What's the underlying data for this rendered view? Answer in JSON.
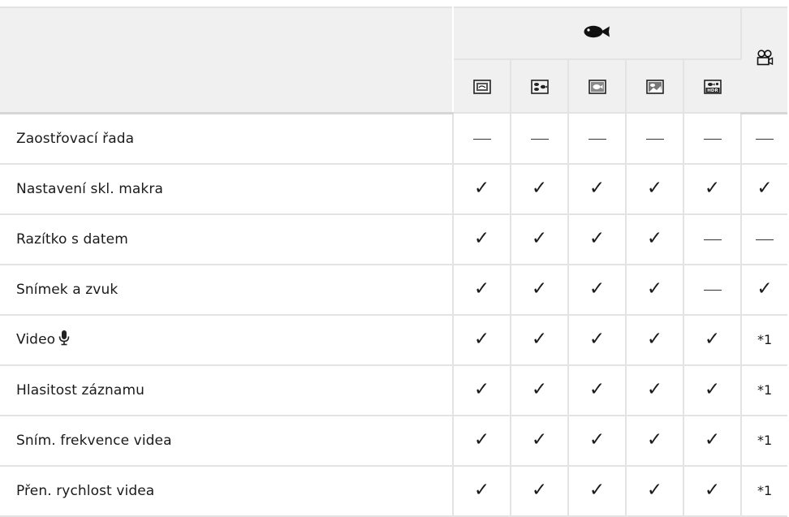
{
  "header": {
    "group_icon": "underwater-fish-icon",
    "movie_icon": "movie-camera-icon",
    "modes": [
      {
        "icon": "underwater-wide-icon"
      },
      {
        "icon": "underwater-macro-icon"
      },
      {
        "icon": "underwater-snapshot-icon"
      },
      {
        "icon": "underwater-landscape-icon"
      },
      {
        "icon": "underwater-hdr-icon",
        "badge": "HDR"
      }
    ]
  },
  "rows": [
    {
      "label": "Zaostřovací řada",
      "values": [
        "—",
        "—",
        "—",
        "—",
        "—",
        "—"
      ]
    },
    {
      "label": "Nastavení skl. makra",
      "values": [
        "✓",
        "✓",
        "✓",
        "✓",
        "✓",
        "✓"
      ]
    },
    {
      "label": "Razítko s datem",
      "values": [
        "✓",
        "✓",
        "✓",
        "✓",
        "—",
        "—"
      ]
    },
    {
      "label": "Snímek a zvuk",
      "values": [
        "✓",
        "✓",
        "✓",
        "✓",
        "—",
        "✓"
      ]
    },
    {
      "label": "Video",
      "label_icon": "microphone-icon",
      "values": [
        "✓",
        "✓",
        "✓",
        "✓",
        "✓",
        "*1"
      ]
    },
    {
      "label": "Hlasitost záznamu",
      "values": [
        "✓",
        "✓",
        "✓",
        "✓",
        "✓",
        "*1"
      ]
    },
    {
      "label": "Sním. frekvence videa",
      "values": [
        "✓",
        "✓",
        "✓",
        "✓",
        "✓",
        "*1"
      ]
    },
    {
      "label": "Přen. rychlost videa",
      "values": [
        "✓",
        "✓",
        "✓",
        "✓",
        "✓",
        "*1"
      ]
    }
  ]
}
